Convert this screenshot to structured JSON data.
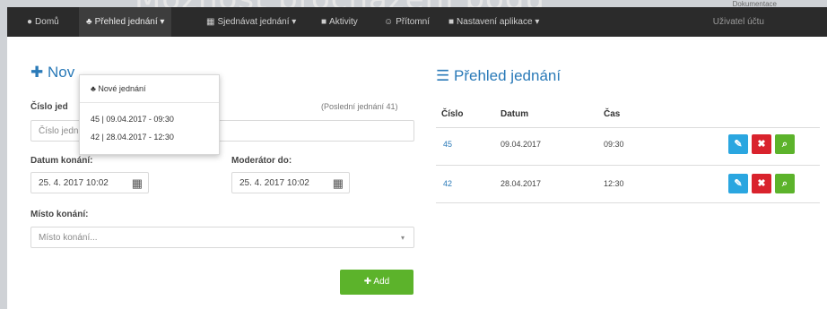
{
  "slide": {
    "title": "Možnost procházení bodů",
    "corner_label": "Dokumentace"
  },
  "nav": {
    "home": "Domů",
    "meetings_active": "Přehled jednání ▾",
    "reports": "Sjednávat jednání ▾",
    "activities": "Aktivity",
    "people": "Přítomní",
    "settings": "Nastavení aplikace ▾",
    "user": "Uživatel účtu"
  },
  "dropdown": {
    "new_meeting": "Nové jednání",
    "entries": [
      "45 | 09.04.2017 - 09:30",
      "42 | 28.04.2017 - 12:30"
    ]
  },
  "form": {
    "title": "Nov",
    "number_label": "Číslo jed",
    "number_hint": "(Poslední jednání 41)",
    "number_placeholder": "Číslo jednání...",
    "date_label": "Datum konání:",
    "date_value": "25. 4. 2017 10:02",
    "deadline_label": "Moderátor do:",
    "deadline_value": "25. 4. 2017 10:02",
    "place_label": "Místo konání:",
    "place_placeholder": "Místo konání...",
    "add_button": "Add"
  },
  "overview": {
    "title": "Přehled jednání",
    "columns": [
      "Číslo",
      "Datum",
      "Čas"
    ],
    "rows": [
      {
        "number": "45",
        "date": "09.04.2017",
        "time": "09:30"
      },
      {
        "number": "42",
        "date": "28.04.2017",
        "time": "12:30"
      }
    ]
  }
}
